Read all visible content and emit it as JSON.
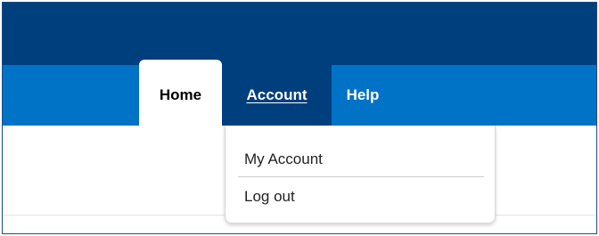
{
  "nav": {
    "tabs": [
      {
        "label": "Home",
        "state": "active"
      },
      {
        "label": "Account",
        "state": "open"
      },
      {
        "label": "Help",
        "state": "normal"
      }
    ]
  },
  "account_menu": {
    "items": [
      {
        "label": "My Account"
      },
      {
        "label": "Log out"
      }
    ]
  },
  "colors": {
    "header_dark": "#003f7e",
    "nav_blue": "#0073c6",
    "background": "#ffffff"
  }
}
